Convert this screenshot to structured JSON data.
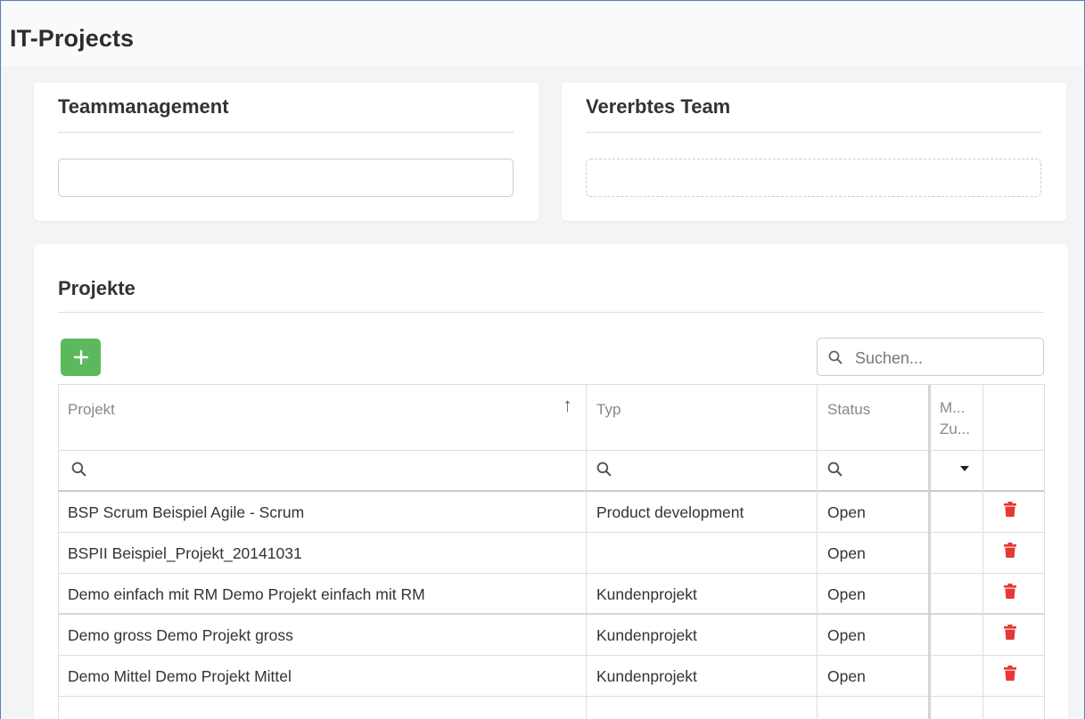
{
  "app": {
    "title": "IT-Projects"
  },
  "teammanagement": {
    "title": "Teammanagement"
  },
  "vererbtes_team": {
    "title": "Vererbtes Team"
  },
  "projekte": {
    "title": "Projekte",
    "search_placeholder": "Suchen...",
    "columns": {
      "projekt": "Projekt",
      "typ": "Typ",
      "status": "Status",
      "m_line1": "M...",
      "m_line2": "Zu..."
    },
    "rows": [
      {
        "projekt": "BSP Scrum Beispiel Agile - Scrum",
        "typ": "Product development",
        "status": "Open"
      },
      {
        "projekt": "BSPII Beispiel_Projekt_20141031",
        "typ": "",
        "status": "Open"
      },
      {
        "projekt": "Demo einfach mit RM Demo Projekt einfach mit RM",
        "typ": "Kundenprojekt",
        "status": "Open"
      },
      {
        "projekt": "Demo gross Demo Projekt gross",
        "typ": "Kundenprojekt",
        "status": "Open"
      },
      {
        "projekt": "Demo Mittel Demo Projekt Mittel",
        "typ": "Kundenprojekt",
        "status": "Open"
      }
    ]
  },
  "colors": {
    "add_button": "#5cb85c",
    "delete_icon": "#e53935",
    "frame_border": "#5b7fb5"
  },
  "icons": {
    "add": "plus-icon",
    "search": "search-icon",
    "delete": "trash-icon",
    "sort": "sort-ascending-icon",
    "dropdown": "caret-down-icon"
  }
}
